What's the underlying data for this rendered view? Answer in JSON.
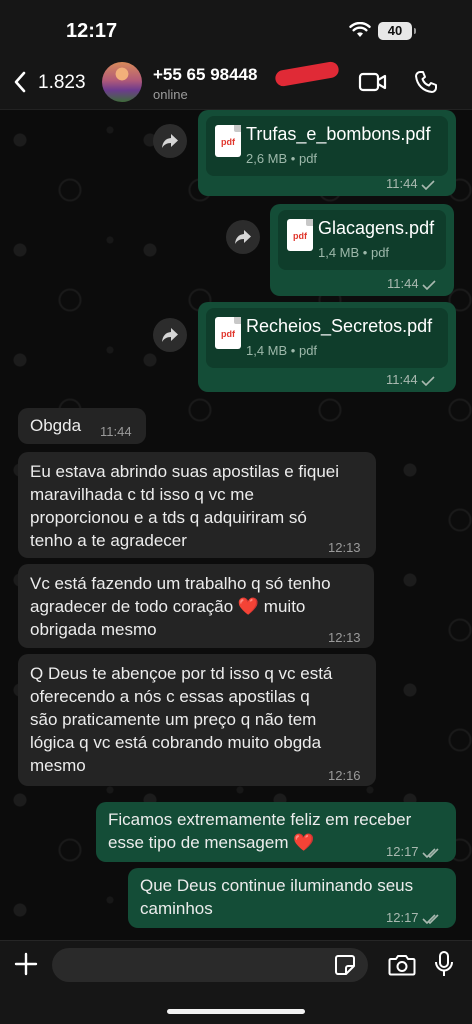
{
  "status_bar": {
    "time": "12:17",
    "battery": "40"
  },
  "header": {
    "back_count": "1.823",
    "contact_name": "+55 65 98448",
    "contact_status": "online"
  },
  "messages": [
    {
      "type": "document",
      "direction": "out",
      "name": "Trufas_e_bombons.pdf",
      "meta": "2,6 MB • pdf",
      "time": "11:44",
      "icon_label": "pdf"
    },
    {
      "type": "document",
      "direction": "out",
      "name": "Glacagens.pdf",
      "meta": "1,4 MB • pdf",
      "time": "11:44",
      "icon_label": "pdf"
    },
    {
      "type": "document",
      "direction": "out",
      "name": "Recheios_Secretos.pdf",
      "meta": "1,4 MB • pdf",
      "time": "11:44",
      "icon_label": "pdf"
    },
    {
      "type": "text",
      "direction": "in",
      "text": "Obgda",
      "time": "11:44"
    },
    {
      "type": "text",
      "direction": "in",
      "lines": [
        "Eu estava abrindo suas apostilas e fiquei",
        "maravilhada c td isso q vc me",
        "proporcionou e a tds q adquiriram só",
        "tenho a te agradecer"
      ],
      "time": "12:13"
    },
    {
      "type": "text",
      "direction": "in",
      "lines": [
        "Vc está fazendo um trabalho q só tenho",
        "agradecer de todo coração ❤️ muito",
        "obrigada mesmo"
      ],
      "time": "12:13"
    },
    {
      "type": "text",
      "direction": "in",
      "lines": [
        "Q Deus te abençoe por td isso q vc está",
        "oferecendo a nós c essas apostilas q",
        "são praticamente um preço q não tem",
        "lógica q vc está cobrando muito obgda",
        "mesmo"
      ],
      "time": "12:16"
    },
    {
      "type": "text",
      "direction": "out",
      "lines": [
        "Ficamos extremamente feliz em receber",
        "esse tipo de mensagem ❤️"
      ],
      "time": "12:17"
    },
    {
      "type": "text",
      "direction": "out",
      "lines": [
        "Que Deus continue iluminando seus",
        "caminhos"
      ],
      "time": "12:17"
    }
  ],
  "input": {
    "value": "",
    "placeholder": ""
  },
  "colors": {
    "outgoing_bubble": "#144d37",
    "incoming_bubble": "#242424",
    "read_tick": "#a9b9b0"
  }
}
